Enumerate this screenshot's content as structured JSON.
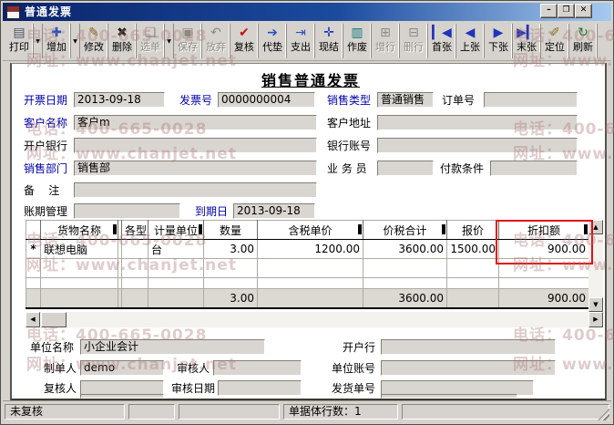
{
  "window": {
    "title": "普通发票",
    "controls": {
      "minimize": "–",
      "maximize": "❐",
      "close": "✕"
    }
  },
  "toolbar": {
    "dropdown_glyph": "▼",
    "buttons": [
      {
        "label": "打印",
        "glyph": "▤",
        "icon_color": "#50506a",
        "enabled": true,
        "dropdown": true
      },
      {
        "label": "增加",
        "glyph": "✚",
        "icon_color": "#2a52be",
        "enabled": true,
        "dropdown": true
      },
      {
        "label": "修改",
        "glyph": "✎",
        "icon_color": "#8a6d1a",
        "enabled": true,
        "dropdown": false
      },
      {
        "label": "删除",
        "glyph": "✖",
        "icon_color": "#1a1a1a",
        "enabled": true,
        "dropdown": false
      },
      {
        "label": "选单",
        "glyph": "❏",
        "icon_color": "#8d8a82",
        "enabled": false,
        "dropdown": true
      },
      {
        "label": "保存",
        "glyph": "▣",
        "icon_color": "#8d8a82",
        "enabled": false,
        "dropdown": false
      },
      {
        "label": "放弃",
        "glyph": "↶",
        "icon_color": "#8d8a82",
        "enabled": false,
        "dropdown": false
      },
      {
        "label": "复核",
        "glyph": "✔",
        "icon_color": "#c11111",
        "enabled": true,
        "dropdown": false
      },
      {
        "label": "代垫",
        "glyph": "➔",
        "icon_color": "#2a52be",
        "enabled": true,
        "dropdown": false
      },
      {
        "label": "支出",
        "glyph": "⇥",
        "icon_color": "#2a52be",
        "enabled": true,
        "dropdown": false
      },
      {
        "label": "现结",
        "glyph": "✛",
        "icon_color": "#2233bb",
        "enabled": true,
        "dropdown": false
      },
      {
        "label": "作废",
        "glyph": "▥",
        "icon_color": "#0a7a7a",
        "enabled": true,
        "dropdown": false
      },
      {
        "label": "增行",
        "glyph": "⊞",
        "icon_color": "#8d8a82",
        "enabled": false,
        "dropdown": false
      },
      {
        "label": "删行",
        "glyph": "⊟",
        "icon_color": "#8d8a82",
        "enabled": false,
        "dropdown": false
      },
      {
        "label": "首张",
        "glyph": "▎◀",
        "icon_color": "#2233bb",
        "enabled": true,
        "dropdown": false
      },
      {
        "label": "上张",
        "glyph": "◀",
        "icon_color": "#2233bb",
        "enabled": true,
        "dropdown": false
      },
      {
        "label": "下张",
        "glyph": "▶",
        "icon_color": "#2233bb",
        "enabled": true,
        "dropdown": false
      },
      {
        "label": "末张",
        "glyph": "▶▎",
        "icon_color": "#2233bb",
        "enabled": true,
        "dropdown": false
      },
      {
        "label": "定位",
        "glyph": "✐",
        "icon_color": "#8a6d1a",
        "enabled": true,
        "dropdown": false
      },
      {
        "label": "刷新",
        "glyph": "↻",
        "icon_color": "#0a8a2a",
        "enabled": true,
        "dropdown": false
      }
    ]
  },
  "form": {
    "title": "销售普通发票",
    "fields": {
      "invoice_date": {
        "label": "开票日期",
        "value": "2013-09-18"
      },
      "invoice_no": {
        "label": "发票号",
        "value": "0000000004"
      },
      "sales_type": {
        "label": "销售类型",
        "value": "普通销售"
      },
      "order_no": {
        "label": "订单号",
        "value": ""
      },
      "customer_name": {
        "label": "客户名称",
        "value": "客户m"
      },
      "customer_addr": {
        "label": "客户地址",
        "value": ""
      },
      "bank": {
        "label": "开户银行",
        "value": ""
      },
      "bank_account": {
        "label": "银行账号",
        "value": ""
      },
      "sales_dept": {
        "label": "销售部门",
        "value": "销售部"
      },
      "salesman": {
        "label": "业 务 员",
        "value": ""
      },
      "payment_terms": {
        "label": "付款条件",
        "value": ""
      },
      "remark": {
        "label": "备    注",
        "value": ""
      },
      "period_mgmt": {
        "label": "账期管理",
        "value": ""
      },
      "due_date": {
        "label": "到期日",
        "value": "2013-09-18"
      }
    }
  },
  "table": {
    "header": [
      "",
      "货物名称",
      "",
      "各型",
      "计量单位",
      "数量",
      "含税单价",
      "价税合计",
      "报价",
      "折扣额"
    ],
    "row1": [
      "*",
      "联想电脑",
      "",
      "",
      "台",
      "3.00",
      "1200.00",
      "3600.00",
      "1500.00",
      "900.00"
    ],
    "row2": [
      "",
      "",
      "",
      "",
      "",
      "",
      "",
      "",
      "",
      ""
    ],
    "row3": [
      "",
      "",
      "",
      "",
      "",
      "",
      "",
      "",
      "",
      ""
    ],
    "totals": [
      "",
      "",
      "",
      "",
      "",
      "3.00",
      "",
      "3600.00",
      "",
      "900.00"
    ],
    "highlight_color": "#e01010"
  },
  "footer": {
    "unit_name": {
      "label": "单位名称",
      "value": "小企业会计"
    },
    "open_bank": {
      "label": "开户行",
      "value": ""
    },
    "maker": {
      "label": "制单人",
      "value": "demo"
    },
    "auditor": {
      "label": "审核人",
      "value": ""
    },
    "unit_account": {
      "label": "单位账号",
      "value": ""
    },
    "rechecker": {
      "label": "复核人",
      "value": ""
    },
    "audit_date": {
      "label": "审核日期",
      "value": ""
    },
    "delivery_no": {
      "label": "发货单号",
      "value": ""
    }
  },
  "statusbar": {
    "panels": [
      "未复核",
      "",
      "",
      "单据体行数：1",
      ""
    ]
  },
  "watermark": {
    "phone": "电话：400-665-0028",
    "site": "网址：www.chanjet.net"
  },
  "colors": {
    "titlebar_start": "#0a246a",
    "titlebar_end": "#a6caf0",
    "chrome": "#d6d3ce",
    "required_label": "#0000a8",
    "field_bg": "#d9d6d1",
    "highlight": "#e01010"
  }
}
